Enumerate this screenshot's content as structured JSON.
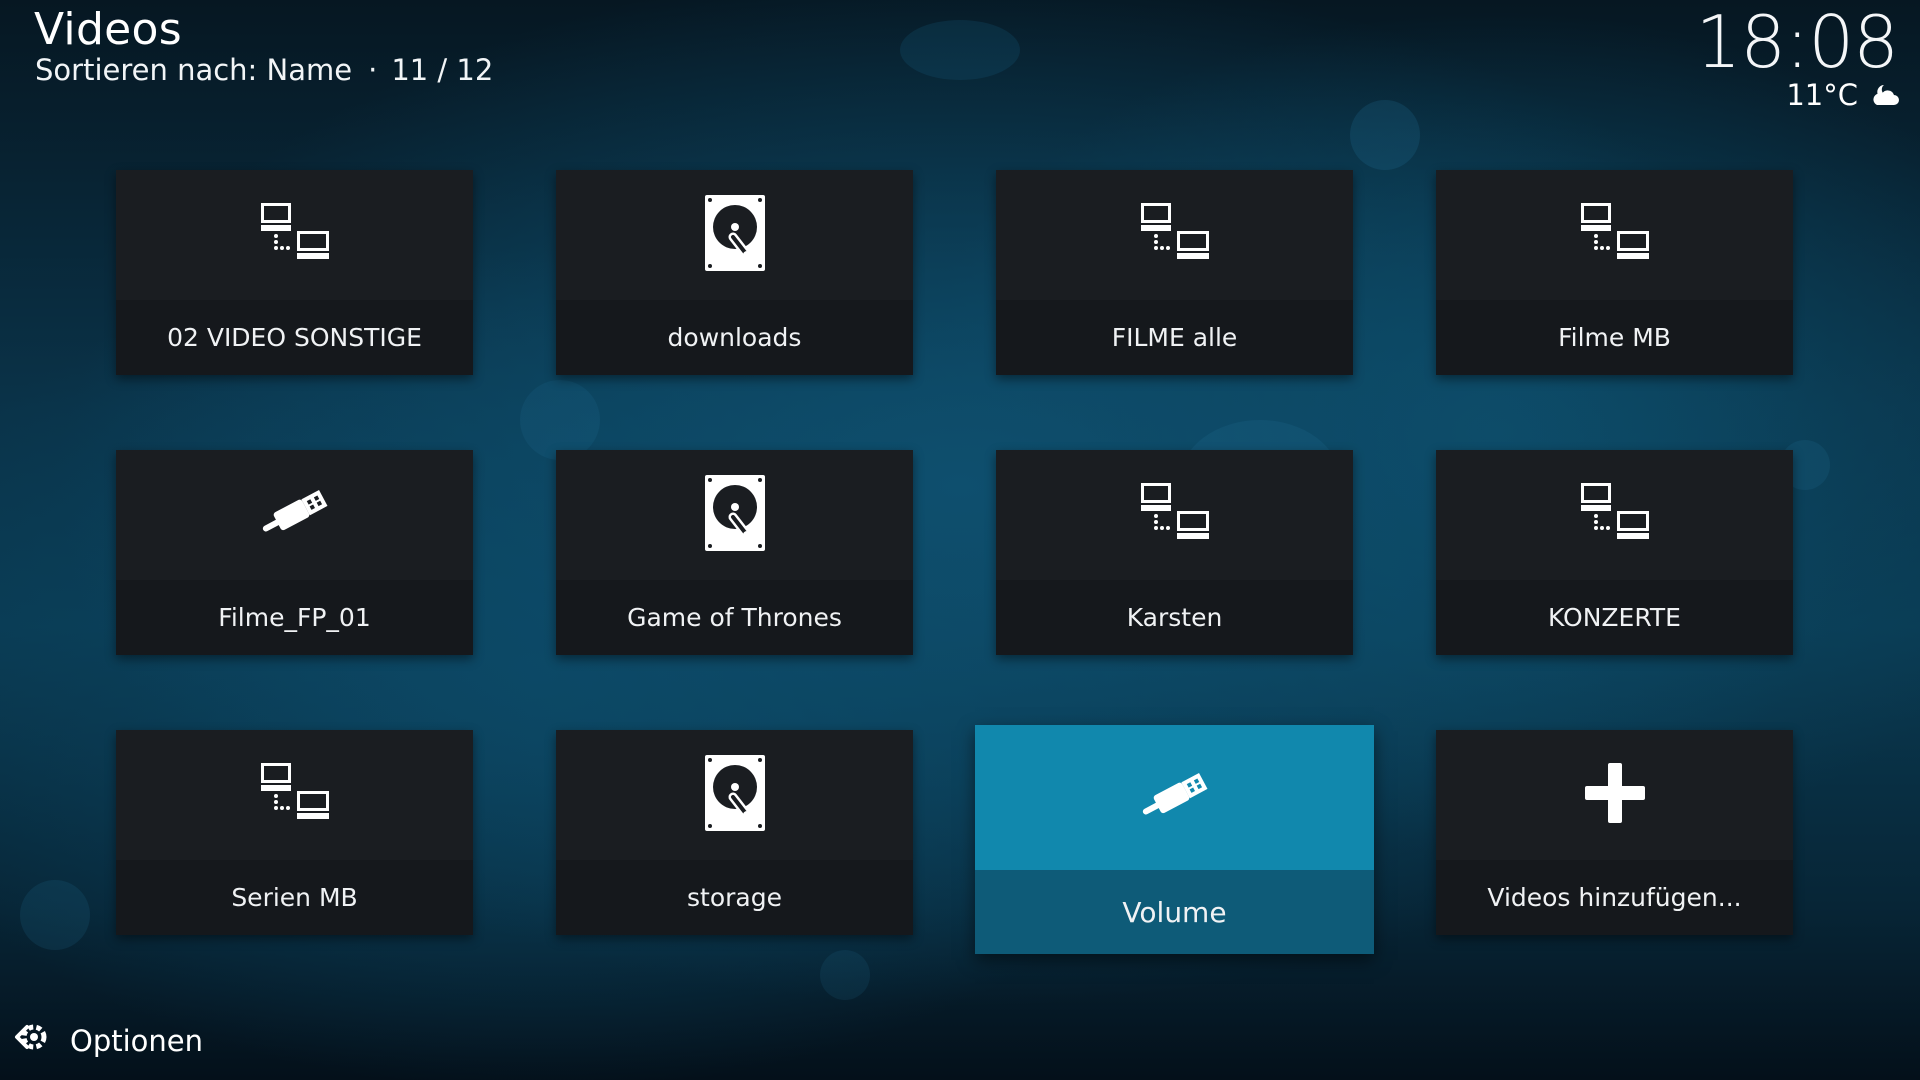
{
  "header": {
    "title": "Videos",
    "sort_label": "Sortieren nach: Name",
    "separator": "·",
    "position": "11 / 12"
  },
  "clock": {
    "time": "18:08"
  },
  "weather": {
    "temperature": "11°C",
    "icon": "partly-cloudy-night-icon"
  },
  "grid": {
    "items": [
      {
        "label": "02 VIDEO SONSTIGE",
        "icon": "network-icon"
      },
      {
        "label": "downloads",
        "icon": "hard-disk-icon"
      },
      {
        "label": "FILME alle",
        "icon": "network-icon"
      },
      {
        "label": "Filme MB",
        "icon": "network-icon"
      },
      {
        "label": "Filme_FP_01",
        "icon": "usb-icon"
      },
      {
        "label": "Game of Thrones",
        "icon": "hard-disk-icon"
      },
      {
        "label": "Karsten",
        "icon": "network-icon"
      },
      {
        "label": "KONZERTE",
        "icon": "network-icon"
      },
      {
        "label": "Serien MB",
        "icon": "network-icon"
      },
      {
        "label": "storage",
        "icon": "hard-disk-icon"
      },
      {
        "label": "Volume",
        "icon": "usb-icon",
        "focused": true
      },
      {
        "label": "Videos hinzufügen...",
        "icon": "add-icon"
      }
    ]
  },
  "footer": {
    "options_label": "Optionen",
    "icon": "gear-back-icon"
  },
  "colors": {
    "tile_bg": "#1a1d21",
    "tile_label_bg": "#15181c",
    "focus_bg": "#1188ad",
    "focus_label_bg": "#0e5b78",
    "background": "#0a3b53"
  }
}
